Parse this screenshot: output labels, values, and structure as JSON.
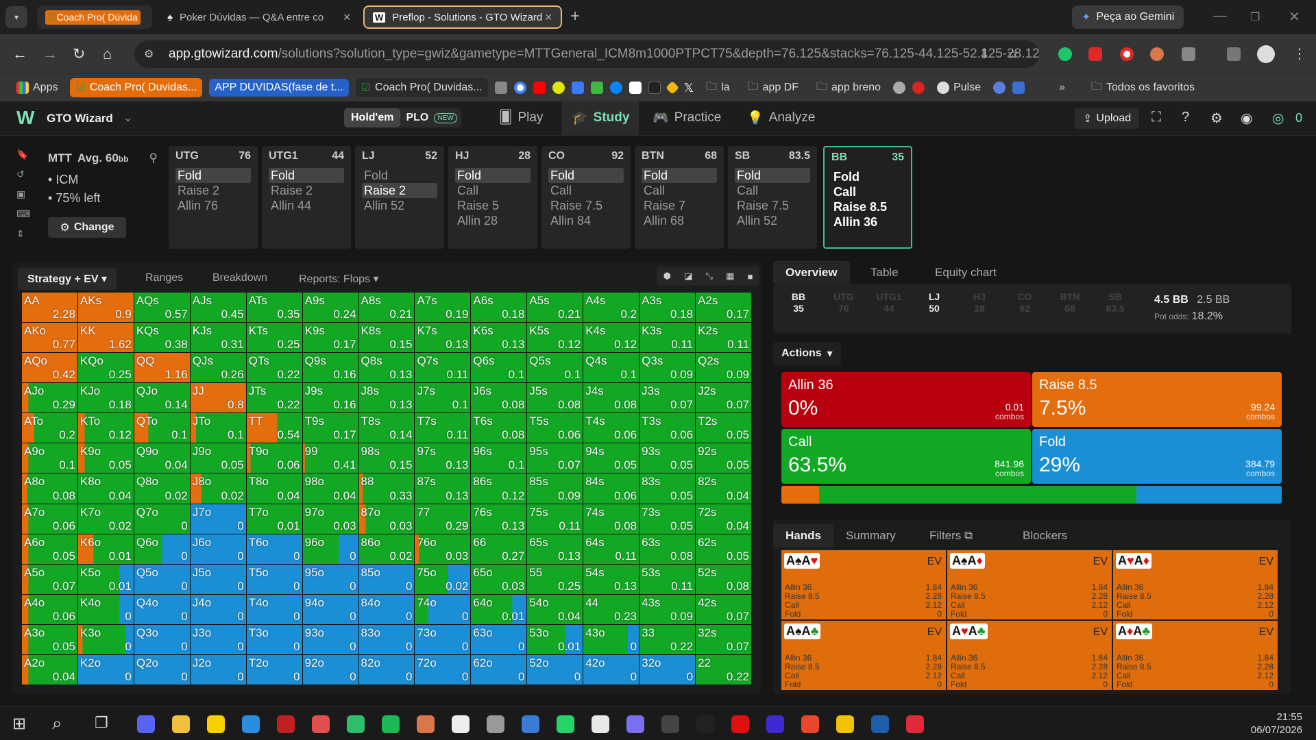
{
  "browser": {
    "tabs": [
      {
        "label": "Coach Pro( Dúvida",
        "active": false
      },
      {
        "label": "Poker Dúvidas — Q&A entre co",
        "active": false
      },
      {
        "label": "Preflop - Solutions - GTO Wizard",
        "active": true
      }
    ],
    "new_tab": "+",
    "gemini": "Peça ao Gemini",
    "url_host": "app.gtowizard.com",
    "url_path": "/solutions?solution_type=gwiz&gametype=MTTGeneral_ICM8m1000PTPCT75&depth=76.125&stacks=76.125-44.125-52.125-28.125...",
    "bookmarks": [
      "Apps",
      "Coach Pro( Duvidas...",
      "APP DUVIDAS(fase de t...",
      "Coach Pro( Duvidas...",
      "la",
      "app DF",
      "app breno",
      "Pulse"
    ],
    "all_bookmarks": "Todos os favoritos"
  },
  "app": {
    "brand": "GTO Wizard",
    "game_holdem": "Hold'em",
    "game_plo": "PLO",
    "badge_new": "NEW",
    "nav": [
      "Play",
      "Study",
      "Practice",
      "Analyze"
    ],
    "upload": "Upload",
    "coins": "0"
  },
  "info": {
    "title": "MTT",
    "avg": "Avg. 60",
    "avg_unit": "bb",
    "bullets": [
      "ICM",
      "75% left"
    ],
    "change": "Change"
  },
  "positions": [
    {
      "name": "UTG",
      "stack": "76",
      "actions": [
        "Fold",
        "Raise 2",
        "Allin 76"
      ],
      "selected": 0
    },
    {
      "name": "UTG1",
      "stack": "44",
      "actions": [
        "Fold",
        "Raise 2",
        "Allin 44"
      ],
      "selected": 0
    },
    {
      "name": "LJ",
      "stack": "52",
      "actions": [
        "Fold",
        "Raise 2",
        "Allin 52"
      ],
      "selected": 1
    },
    {
      "name": "HJ",
      "stack": "28",
      "actions": [
        "Fold",
        "Call",
        "Raise 5",
        "Allin 28"
      ],
      "selected": 0
    },
    {
      "name": "CO",
      "stack": "92",
      "actions": [
        "Fold",
        "Call",
        "Raise 7.5",
        "Allin 84"
      ],
      "selected": 0
    },
    {
      "name": "BTN",
      "stack": "68",
      "actions": [
        "Fold",
        "Call",
        "Raise 7",
        "Allin 68"
      ],
      "selected": 0
    },
    {
      "name": "SB",
      "stack": "83.5",
      "actions": [
        "Fold",
        "Call",
        "Raise 7.5",
        "Allin 52"
      ],
      "selected": 0
    },
    {
      "name": "BB",
      "stack": "35",
      "actions": [
        "Fold",
        "Call",
        "Raise 8.5",
        "Allin 36"
      ],
      "selected": -1
    }
  ],
  "left_tabs": [
    "Strategy + EV",
    "Ranges",
    "Breakdown",
    "Reports: Flops"
  ],
  "right_tabs": [
    "Overview",
    "Table",
    "Equity chart"
  ],
  "pot_positions": [
    {
      "name": "BB",
      "stack": "35",
      "on": true
    },
    {
      "name": "UTG",
      "stack": "76",
      "on": false
    },
    {
      "name": "UTG1",
      "stack": "44",
      "on": false
    },
    {
      "name": "LJ",
      "stack": "50",
      "on": true
    },
    {
      "name": "HJ",
      "stack": "28",
      "on": false
    },
    {
      "name": "CO",
      "stack": "92",
      "on": false
    },
    {
      "name": "BTN",
      "stack": "68",
      "on": false
    },
    {
      "name": "SB",
      "stack": "83.5",
      "on": false
    }
  ],
  "pot": {
    "pot": "4.5 BB",
    "call": "2.5 BB",
    "odds_label": "Pot odds:",
    "odds": "18.2%"
  },
  "actions_label": "Actions",
  "actions": [
    {
      "name": "Allin 36",
      "pct": "0%",
      "combos": "0.01",
      "color": "#b8000f"
    },
    {
      "name": "Raise 8.5",
      "pct": "7.5%",
      "combos": "99.24",
      "color": "#e46d0d"
    },
    {
      "name": "Call",
      "pct": "63.5%",
      "combos": "841.96",
      "color": "#12a824"
    },
    {
      "name": "Fold",
      "pct": "29%",
      "combos": "384.79",
      "color": "#1a8fd6"
    }
  ],
  "combos_word": "combos",
  "freq_bar": [
    {
      "color": "#e46d0d",
      "frac": 0.075
    },
    {
      "color": "#12a824",
      "frac": 0.635
    },
    {
      "color": "#1a8fd6",
      "frac": 0.29
    }
  ],
  "hand_tabs": [
    "Hands",
    "Summary",
    "Filters",
    "Blockers"
  ],
  "hand_cells": [
    {
      "cards": "A♠A♥",
      "lines": [
        [
          "Allin 36",
          "1.84"
        ],
        [
          "Raise 8.5",
          "2.28"
        ],
        [
          "Call",
          "2.12"
        ],
        [
          "Fold",
          "0"
        ]
      ]
    },
    {
      "cards": "A♠A♦",
      "lines": [
        [
          "Allin 36",
          "1.84"
        ],
        [
          "Raise 8.5",
          "2.28"
        ],
        [
          "Call",
          "2.12"
        ],
        [
          "Fold",
          "0"
        ]
      ]
    },
    {
      "cards": "A♥A♦",
      "lines": [
        [
          "Allin 36",
          "1.84"
        ],
        [
          "Raise 8.5",
          "2.28"
        ],
        [
          "Call",
          "2.12"
        ],
        [
          "Fold",
          "0"
        ]
      ]
    },
    {
      "cards": "A♠A♣",
      "lines": [
        [
          "Allin 36",
          "1.84"
        ],
        [
          "Raise 8.5",
          "2.28"
        ],
        [
          "Call",
          "2.12"
        ],
        [
          "Fold",
          "0"
        ]
      ]
    },
    {
      "cards": "A♥A♣",
      "lines": [
        [
          "Allin 36",
          "1.84"
        ],
        [
          "Raise 8.5",
          "2.28"
        ],
        [
          "Call",
          "2.12"
        ],
        [
          "Fold",
          "0"
        ]
      ]
    },
    {
      "cards": "A♦A♣",
      "lines": [
        [
          "Allin 36",
          "1.84"
        ],
        [
          "Raise 8.5",
          "2.28"
        ],
        [
          "Call",
          "2.12"
        ],
        [
          "Fold",
          "0"
        ]
      ]
    }
  ],
  "ev_word": "EV",
  "matrix": {
    "hands": [
      [
        "AA",
        "AKs",
        "AQs",
        "AJs",
        "ATs",
        "A9s",
        "A8s",
        "A7s",
        "A6s",
        "A5s",
        "A4s",
        "A3s",
        "A2s"
      ],
      [
        "AKo",
        "KK",
        "KQs",
        "KJs",
        "KTs",
        "K9s",
        "K8s",
        "K7s",
        "K6s",
        "K5s",
        "K4s",
        "K3s",
        "K2s"
      ],
      [
        "AQo",
        "KQo",
        "QQ",
        "QJs",
        "QTs",
        "Q9s",
        "Q8s",
        "Q7s",
        "Q6s",
        "Q5s",
        "Q4s",
        "Q3s",
        "Q2s"
      ],
      [
        "AJo",
        "KJo",
        "QJo",
        "JJ",
        "JTs",
        "J9s",
        "J8s",
        "J7s",
        "J6s",
        "J5s",
        "J4s",
        "J3s",
        "J2s"
      ],
      [
        "ATo",
        "KTo",
        "QTo",
        "JTo",
        "TT",
        "T9s",
        "T8s",
        "T7s",
        "T6s",
        "T5s",
        "T4s",
        "T3s",
        "T2s"
      ],
      [
        "A9o",
        "K9o",
        "Q9o",
        "J9o",
        "T9o",
        "99",
        "98s",
        "97s",
        "96s",
        "95s",
        "94s",
        "93s",
        "92s"
      ],
      [
        "A8o",
        "K8o",
        "Q8o",
        "J8o",
        "T8o",
        "98o",
        "88",
        "87s",
        "86s",
        "85s",
        "84s",
        "83s",
        "82s"
      ],
      [
        "A7o",
        "K7o",
        "Q7o",
        "J7o",
        "T7o",
        "97o",
        "87o",
        "77",
        "76s",
        "75s",
        "74s",
        "73s",
        "72s"
      ],
      [
        "A6o",
        "K6o",
        "Q6o",
        "J6o",
        "T6o",
        "96o",
        "86o",
        "76o",
        "66",
        "65s",
        "64s",
        "63s",
        "62s"
      ],
      [
        "A5o",
        "K5o",
        "Q5o",
        "J5o",
        "T5o",
        "95o",
        "85o",
        "75o",
        "65o",
        "55",
        "54s",
        "53s",
        "52s"
      ],
      [
        "A4o",
        "K4o",
        "Q4o",
        "J4o",
        "T4o",
        "94o",
        "84o",
        "74o",
        "64o",
        "54o",
        "44",
        "43s",
        "42s"
      ],
      [
        "A3o",
        "K3o",
        "Q3o",
        "J3o",
        "T3o",
        "93o",
        "83o",
        "73o",
        "63o",
        "53o",
        "43o",
        "33",
        "32s"
      ],
      [
        "A2o",
        "K2o",
        "Q2o",
        "J2o",
        "T2o",
        "92o",
        "82o",
        "72o",
        "62o",
        "52o",
        "42o",
        "32o",
        "22"
      ]
    ],
    "evs": [
      [
        "2.28",
        "0.9",
        "0.57",
        "0.45",
        "0.35",
        "0.24",
        "0.21",
        "0.19",
        "0.18",
        "0.21",
        "0.2",
        "0.18",
        "0.17"
      ],
      [
        "0.77",
        "1.62",
        "0.38",
        "0.31",
        "0.25",
        "0.17",
        "0.15",
        "0.13",
        "0.13",
        "0.12",
        "0.12",
        "0.11",
        "0.11"
      ],
      [
        "0.42",
        "0.25",
        "1.16",
        "0.26",
        "0.22",
        "0.16",
        "0.13",
        "0.11",
        "0.1",
        "0.1",
        "0.1",
        "0.09",
        "0.09"
      ],
      [
        "0.29",
        "0.18",
        "0.14",
        "0.8",
        "0.22",
        "0.16",
        "0.13",
        "0.1",
        "0.08",
        "0.08",
        "0.08",
        "0.07",
        "0.07"
      ],
      [
        "0.2",
        "0.12",
        "0.1",
        "0.1",
        "0.54",
        "0.17",
        "0.14",
        "0.11",
        "0.08",
        "0.06",
        "0.06",
        "0.06",
        "0.05"
      ],
      [
        "0.1",
        "0.05",
        "0.04",
        "0.05",
        "0.06",
        "0.41",
        "0.15",
        "0.13",
        "0.1",
        "0.07",
        "0.05",
        "0.05",
        "0.05"
      ],
      [
        "0.08",
        "0.04",
        "0.02",
        "0.02",
        "0.04",
        "0.04",
        "0.33",
        "0.13",
        "0.12",
        "0.09",
        "0.06",
        "0.05",
        "0.04"
      ],
      [
        "0.06",
        "0.02",
        "0",
        "0",
        "0.01",
        "0.03",
        "0.03",
        "0.29",
        "0.13",
        "0.11",
        "0.08",
        "0.05",
        "0.04"
      ],
      [
        "0.05",
        "0.01",
        "0",
        "0",
        "0",
        "0",
        "0.02",
        "0.03",
        "0.27",
        "0.13",
        "0.11",
        "0.08",
        "0.05"
      ],
      [
        "0.07",
        "0.01",
        "0",
        "0",
        "0",
        "0",
        "0",
        "0.02",
        "0.03",
        "0.25",
        "0.13",
        "0.11",
        "0.08"
      ],
      [
        "0.06",
        "0",
        "0",
        "0",
        "0",
        "0",
        "0",
        "0",
        "0.01",
        "0.04",
        "0.23",
        "0.09",
        "0.07"
      ],
      [
        "0.05",
        "0",
        "0",
        "0",
        "0",
        "0",
        "0",
        "0",
        "0",
        "0.01",
        "0",
        "0.22",
        "0.07"
      ],
      [
        "0.04",
        "0",
        "0",
        "0",
        "0",
        "0",
        "0",
        "0",
        "0",
        "0",
        "0",
        "0",
        "0.22"
      ]
    ]
  },
  "taskbar": {
    "time": "21:55",
    "date": "06/07/2026"
  }
}
